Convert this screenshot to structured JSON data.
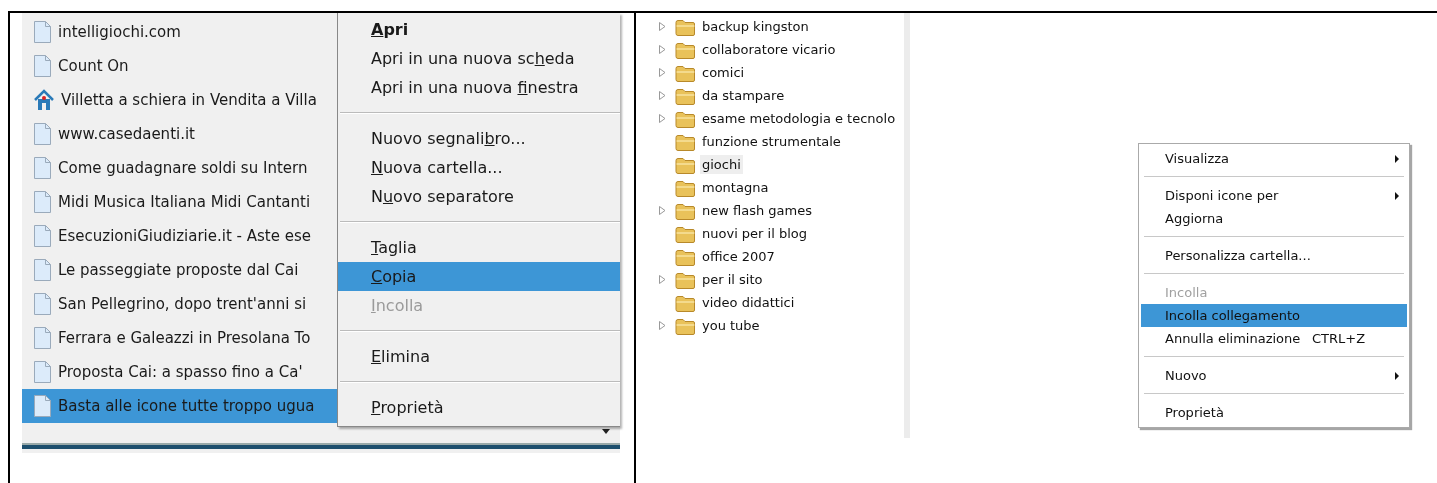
{
  "bookmarks": {
    "items": [
      {
        "kind": "page",
        "label": "intelligiochi.com",
        "selected": false
      },
      {
        "kind": "page",
        "label": "Count On",
        "selected": false
      },
      {
        "kind": "home",
        "label": "Villetta a schiera in Vendita a Villa",
        "selected": false
      },
      {
        "kind": "page",
        "label": "www.casedaenti.it",
        "selected": false
      },
      {
        "kind": "page",
        "label": "Come guadagnare soldi su Intern",
        "selected": false
      },
      {
        "kind": "page",
        "label": "Midi Musica Italiana Midi Cantanti",
        "selected": false
      },
      {
        "kind": "page",
        "label": "EsecuzioniGiudiziarie.it - Aste ese",
        "selected": false
      },
      {
        "kind": "page",
        "label": "Le passeggiate proposte dal Cai",
        "selected": false
      },
      {
        "kind": "page",
        "label": "San Pellegrino, dopo trent'anni si",
        "selected": false
      },
      {
        "kind": "page",
        "label": "Ferrara e Galeazzi in Presolana To",
        "selected": false
      },
      {
        "kind": "page",
        "label": "Proposta Cai: a spasso fino a Ca'",
        "selected": false
      },
      {
        "kind": "page",
        "label": "Basta alle icone tutte troppo ugua",
        "selected": true
      }
    ]
  },
  "bookmark_menu": {
    "items": [
      {
        "kind": "item",
        "key": "A",
        "after": "pri",
        "default": true,
        "selected": false,
        "disabled": false
      },
      {
        "kind": "item",
        "before": "Apri in una nuova sc",
        "key": "h",
        "after": "eda",
        "default": false,
        "selected": false,
        "disabled": false
      },
      {
        "kind": "item",
        "before": "Apri in una nuova ",
        "key": "f",
        "after": "inestra",
        "default": false,
        "selected": false,
        "disabled": false
      },
      {
        "kind": "separator"
      },
      {
        "kind": "item",
        "before": "Nuovo segnali",
        "key": "b",
        "after": "ro...",
        "default": false,
        "selected": false,
        "disabled": false
      },
      {
        "kind": "item",
        "key": "N",
        "after": "uova cartella...",
        "default": false,
        "selected": false,
        "disabled": false
      },
      {
        "kind": "item",
        "before": "N",
        "key": "u",
        "after": "ovo separatore",
        "default": false,
        "selected": false,
        "disabled": false
      },
      {
        "kind": "separator"
      },
      {
        "kind": "item",
        "key": "T",
        "after": "aglia",
        "default": false,
        "selected": false,
        "disabled": false
      },
      {
        "kind": "item",
        "key": "C",
        "after": "opia",
        "default": false,
        "selected": true,
        "disabled": false
      },
      {
        "kind": "item",
        "key": "I",
        "after": "ncolla",
        "default": false,
        "selected": false,
        "disabled": true
      },
      {
        "kind": "separator"
      },
      {
        "kind": "item",
        "key": "E",
        "after": "limina",
        "default": false,
        "selected": false,
        "disabled": false
      },
      {
        "kind": "separator"
      },
      {
        "kind": "item",
        "key": "P",
        "after": "roprietà",
        "default": false,
        "selected": false,
        "disabled": false
      }
    ]
  },
  "folder_tree": {
    "items": [
      {
        "label": "backup kingston",
        "expandable": true,
        "selected": false
      },
      {
        "label": "collaboratore vicario",
        "expandable": true,
        "selected": false
      },
      {
        "label": "comici",
        "expandable": true,
        "selected": false
      },
      {
        "label": "da stampare",
        "expandable": true,
        "selected": false
      },
      {
        "label": "esame metodologia e tecnolo",
        "expandable": true,
        "selected": false
      },
      {
        "label": "funzione strumentale",
        "expandable": false,
        "selected": false
      },
      {
        "label": "giochi",
        "expandable": false,
        "selected": true
      },
      {
        "label": "montagna",
        "expandable": false,
        "selected": false
      },
      {
        "label": "new flash games",
        "expandable": true,
        "selected": false
      },
      {
        "label": "nuovi per il blog",
        "expandable": false,
        "selected": false
      },
      {
        "label": "office 2007",
        "expandable": false,
        "selected": false
      },
      {
        "label": "per il sito",
        "expandable": true,
        "selected": false
      },
      {
        "label": "video didattici",
        "expandable": false,
        "selected": false
      },
      {
        "label": "you tube",
        "expandable": true,
        "selected": false
      }
    ]
  },
  "folder_menu": {
    "items": [
      {
        "kind": "item",
        "label": "Visualizza",
        "submenu": true,
        "selected": false,
        "disabled": false
      },
      {
        "kind": "separator"
      },
      {
        "kind": "item",
        "label": "Disponi icone per",
        "submenu": true,
        "selected": false,
        "disabled": false
      },
      {
        "kind": "item",
        "label": "Aggiorna",
        "submenu": false,
        "selected": false,
        "disabled": false
      },
      {
        "kind": "separator"
      },
      {
        "kind": "item",
        "label": "Personalizza cartella...",
        "submenu": false,
        "selected": false,
        "disabled": false
      },
      {
        "kind": "separator"
      },
      {
        "kind": "item",
        "label": "Incolla",
        "submenu": false,
        "selected": false,
        "disabled": true
      },
      {
        "kind": "item",
        "label": "Incolla collegamento",
        "submenu": false,
        "selected": true,
        "disabled": false
      },
      {
        "kind": "item",
        "label": "Annulla eliminazione",
        "shortcut": "CTRL+Z",
        "submenu": false,
        "selected": false,
        "disabled": false
      },
      {
        "kind": "separator"
      },
      {
        "kind": "item",
        "label": "Nuovo",
        "submenu": true,
        "selected": false,
        "disabled": false
      },
      {
        "kind": "separator"
      },
      {
        "kind": "item",
        "label": "Proprietà",
        "submenu": false,
        "selected": false,
        "disabled": false
      }
    ]
  }
}
